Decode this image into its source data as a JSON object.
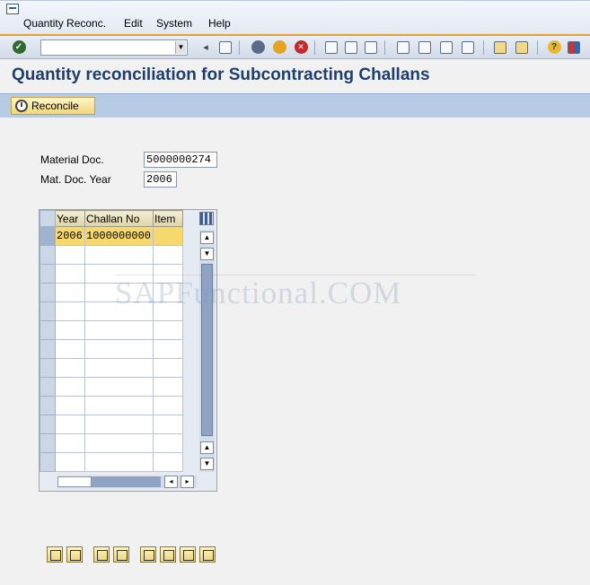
{
  "menu": {
    "items": [
      {
        "label": "Quantity Reconc.",
        "accel": "Q"
      },
      {
        "label": "Edit",
        "accel": "E"
      },
      {
        "label": "System",
        "accel": "S"
      },
      {
        "label": "Help",
        "accel": "H"
      }
    ]
  },
  "toolbar": {
    "command_value": "",
    "icons": [
      "enter-icon",
      "back-icon",
      "save-icon",
      "back-nav-icon",
      "exit-icon",
      "cancel-icon",
      "print-icon",
      "find-icon",
      "find-next-icon",
      "first-page-icon",
      "prev-page-icon",
      "next-page-icon",
      "last-page-icon",
      "new-session-icon",
      "shortcut-icon",
      "help-icon",
      "layout-icon"
    ]
  },
  "page": {
    "title": "Quantity reconciliation for Subcontracting Challans"
  },
  "app_toolbar": {
    "reconcile_label": "Reconcile"
  },
  "fields": {
    "material_doc_label": "Material Doc.",
    "material_doc_value": "5000000274",
    "mat_doc_year_label": "Mat. Doc. Year",
    "mat_doc_year_value": "2006"
  },
  "table": {
    "headers": [
      "Year",
      "Challan No",
      "Item"
    ],
    "rows": [
      [
        "2006",
        "1000000000",
        ""
      ]
    ]
  },
  "watermark": "SAPFunctional.COM",
  "colors": {
    "title": "#1e3f6e",
    "selected_row": "#f6d86d",
    "app_toolbar": "#b7cbe5",
    "accent_line": "#e4a331"
  }
}
